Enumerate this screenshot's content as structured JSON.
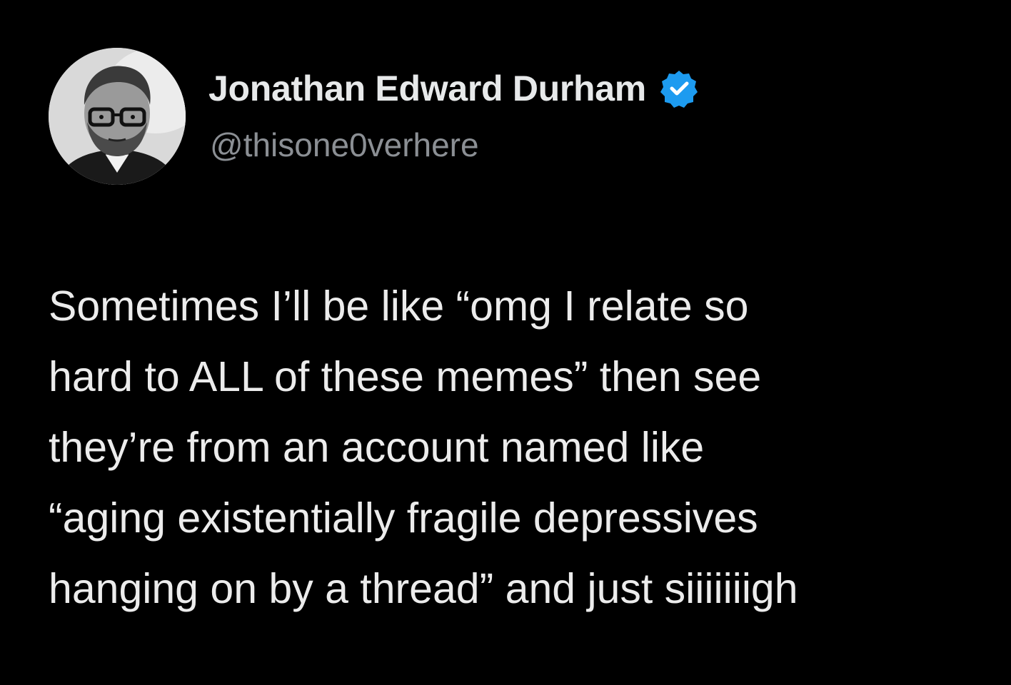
{
  "author": {
    "display_name": "Jonathan Edward Durham",
    "handle": "@thisone0verhere",
    "verified": true,
    "badge_color": "#1d9bf0"
  },
  "tweet": {
    "lines": [
      "Sometimes I’ll be like “omg I relate so",
      "hard to ALL of these memes” then see",
      "they’re from an account named like",
      "“aging existentially fragile depressives",
      "hanging on by a thread” and just siiiiiiigh"
    ]
  },
  "theme": {
    "background": "#000000",
    "text": "#e7e9ea",
    "secondary_text": "#8b8f94"
  },
  "icons": {
    "avatar": "avatar-photo",
    "badge": "verified-badge-icon"
  }
}
